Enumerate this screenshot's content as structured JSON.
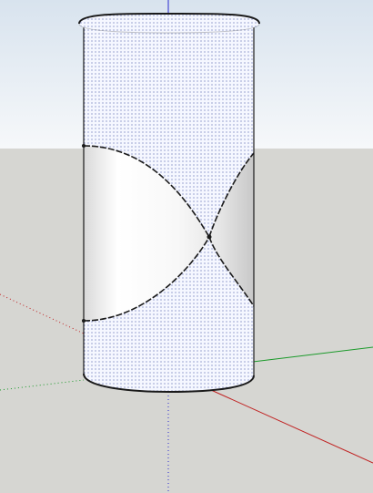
{
  "scene": {
    "title": "",
    "colors": {
      "sky_top": "#d8e3ee",
      "sky_bottom": "#f6f8fa",
      "ground": "#d6d6d2",
      "red_axis": "#c02020",
      "green_axis": "#1b9a2a",
      "blue_axis": "#2a2ad0",
      "cylinder_fill": "#f5f7ff",
      "cylinder_dots": "#5a6ab0",
      "edge": "#1a1a1a"
    },
    "objects": [
      {
        "name": "cylinder",
        "icon": "cylinder-icon",
        "texture": "dotted-blue"
      },
      {
        "name": "helix-cut",
        "icon": "x-curve-icon",
        "texture": "white-shaded"
      }
    ],
    "axes": [
      {
        "name": "red-axis",
        "style": "solid + dotted"
      },
      {
        "name": "green-axis",
        "style": "solid + dotted"
      },
      {
        "name": "blue-axis",
        "style": "solid + dotted"
      }
    ]
  }
}
